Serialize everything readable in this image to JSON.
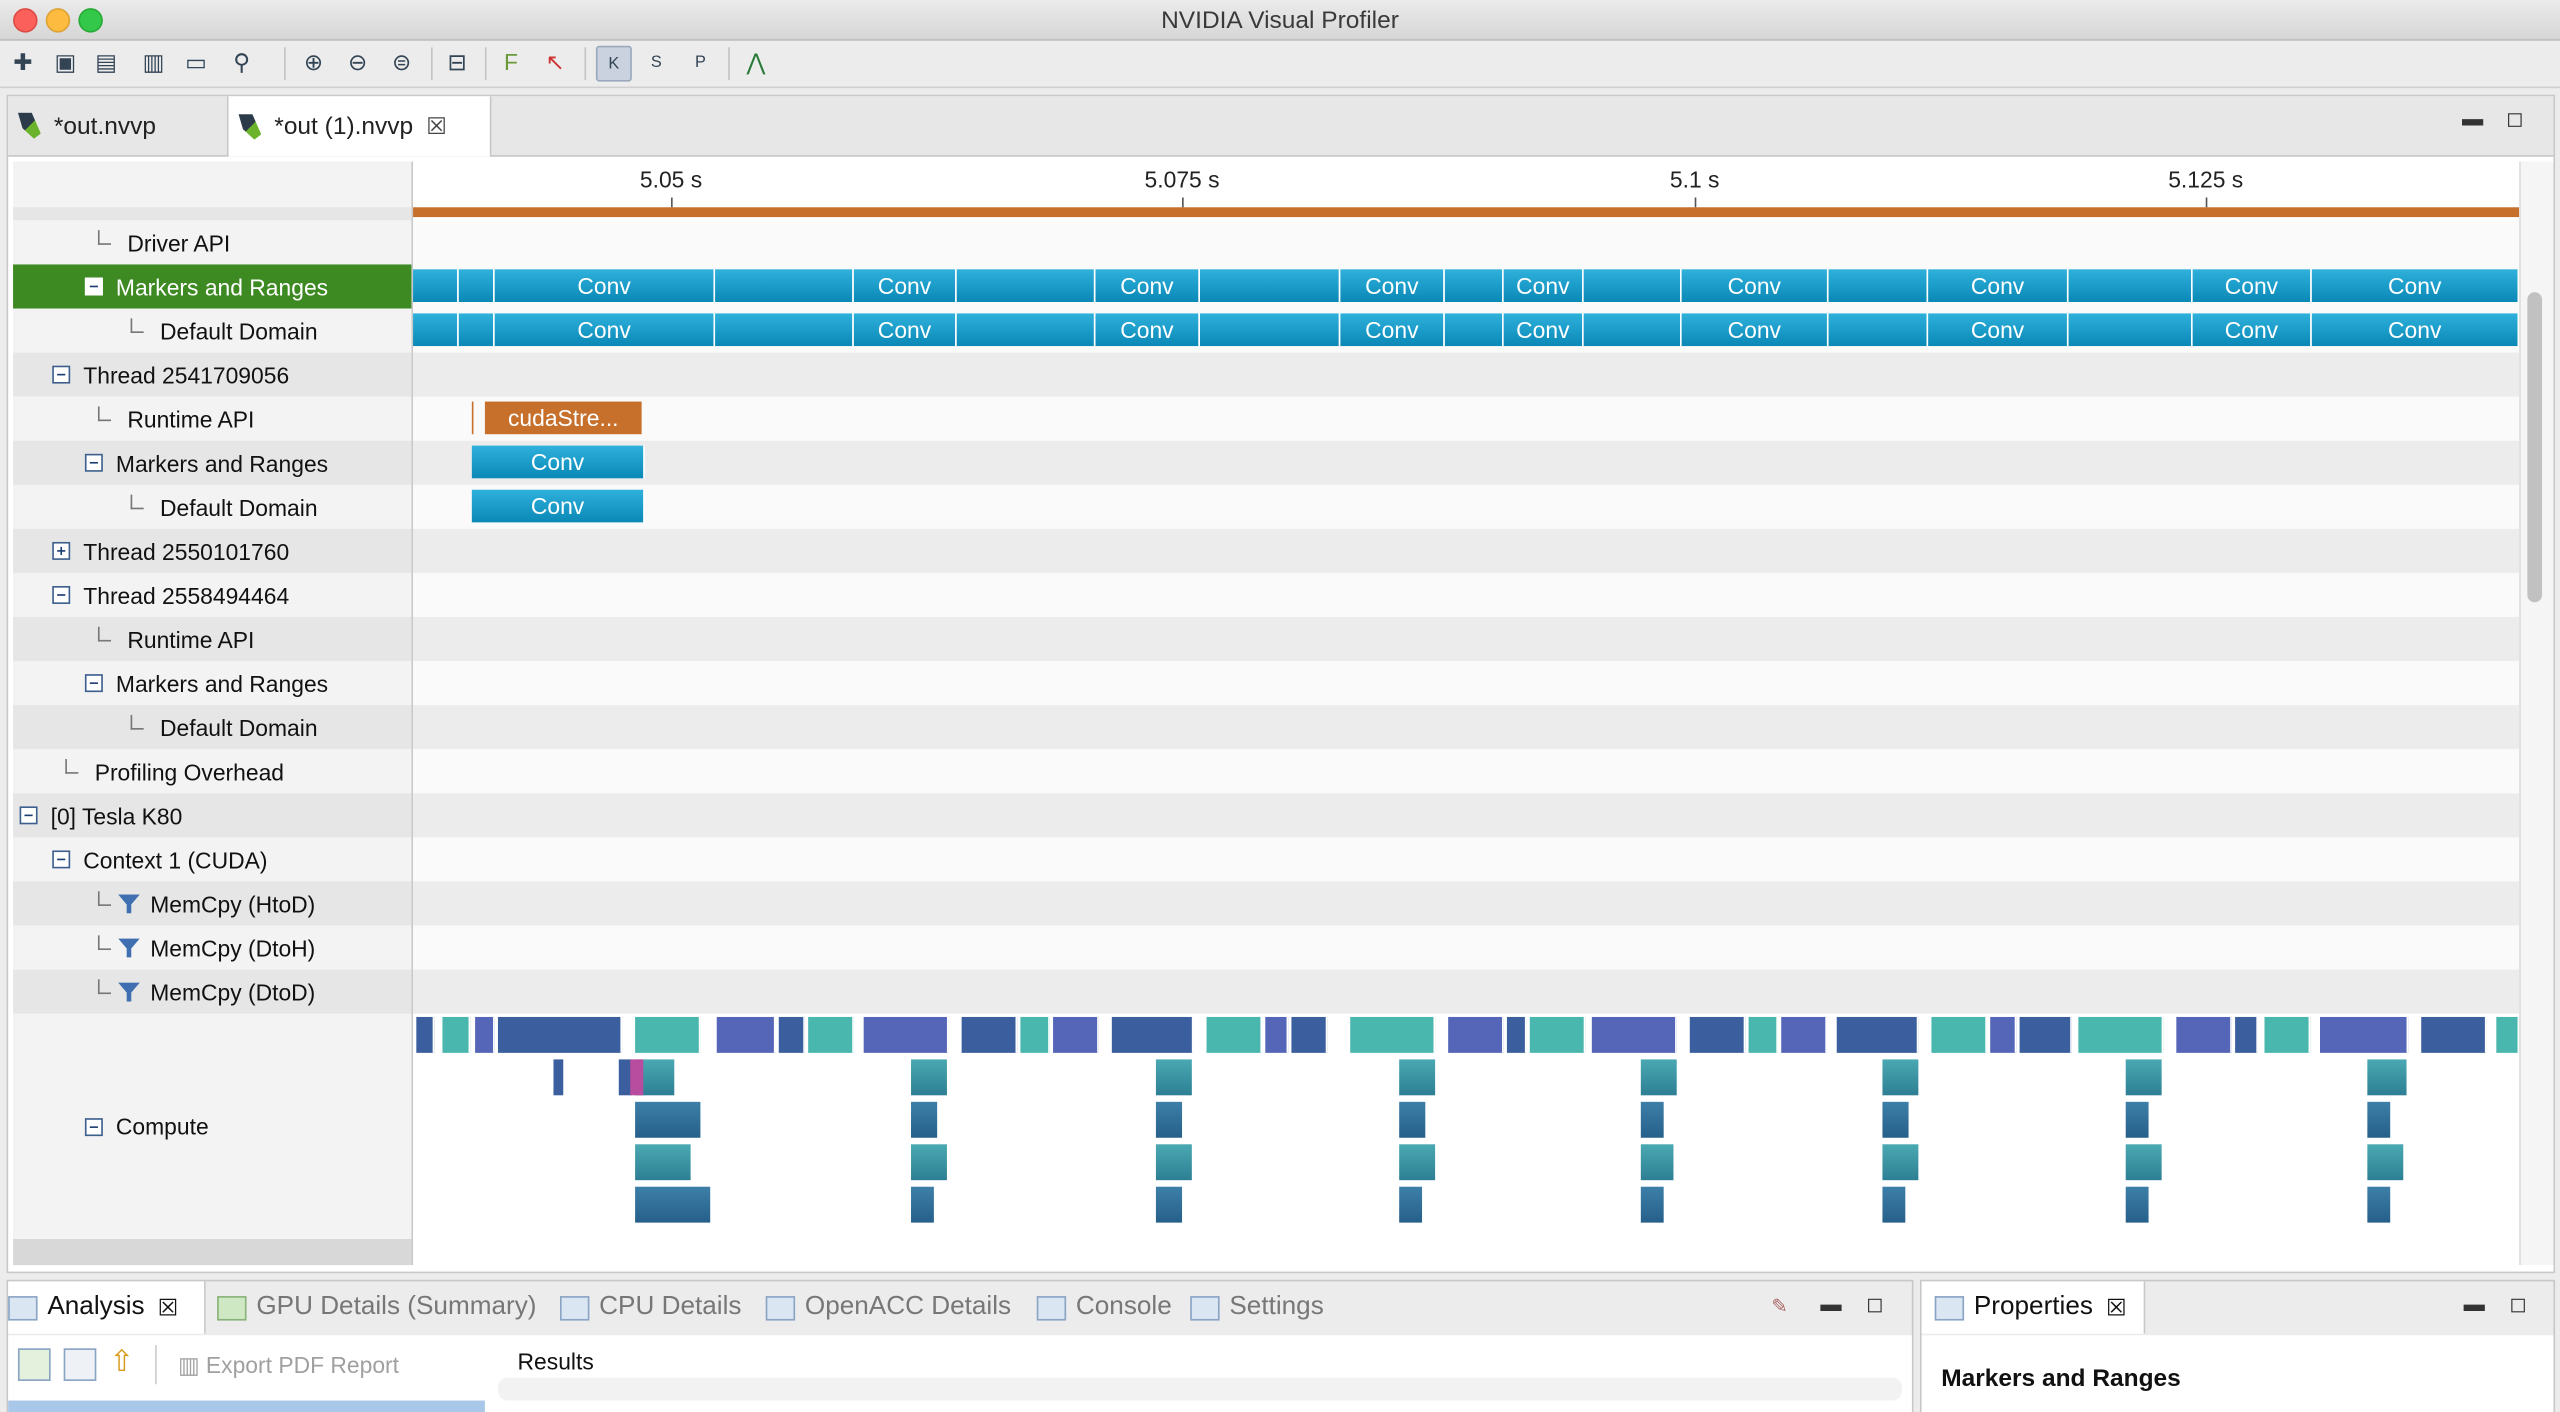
{
  "window": {
    "title": "NVIDIA Visual Profiler"
  },
  "tabs": [
    {
      "label": "*out.nvvp",
      "active": false
    },
    {
      "label": "*out (1).nvvp",
      "active": true
    }
  ],
  "ruler": {
    "ticks": [
      "5.05 s",
      "5.075 s",
      "5.1 s",
      "5.125 s"
    ]
  },
  "tree": [
    {
      "label": "Driver API",
      "kind": "leaf"
    },
    {
      "label": "Markers and Ranges",
      "kind": "minus",
      "selected": true
    },
    {
      "label": "Default Domain",
      "kind": "leaf"
    },
    {
      "label": "Thread 2541709056",
      "kind": "minus"
    },
    {
      "label": "Runtime API",
      "kind": "leaf"
    },
    {
      "label": "Markers and Ranges",
      "kind": "minus"
    },
    {
      "label": "Default Domain",
      "kind": "leaf"
    },
    {
      "label": "Thread 2550101760",
      "kind": "plus"
    },
    {
      "label": "Thread 2558494464",
      "kind": "minus"
    },
    {
      "label": "Runtime API",
      "kind": "leaf"
    },
    {
      "label": "Markers and Ranges",
      "kind": "minus"
    },
    {
      "label": "Default Domain",
      "kind": "leaf"
    },
    {
      "label": "Profiling Overhead",
      "kind": "leaf"
    },
    {
      "label": "[0] Tesla K80",
      "kind": "minus"
    },
    {
      "label": "Context 1 (CUDA)",
      "kind": "minus"
    },
    {
      "label": "MemCpy (HtoD)",
      "kind": "filter"
    },
    {
      "label": "MemCpy (DtoH)",
      "kind": "filter"
    },
    {
      "label": "MemCpy (DtoD)",
      "kind": "filter"
    },
    {
      "label": "Compute",
      "kind": "minus"
    }
  ],
  "timeline": {
    "conv_label": "Conv",
    "cuda_label": "cudaStre..."
  },
  "bottom": {
    "tabs": [
      "Analysis",
      "GPU Details (Summary)",
      "CPU Details",
      "OpenACC Details",
      "Console",
      "Settings"
    ],
    "export_label": "Export PDF Report",
    "results_label": "Results"
  },
  "properties": {
    "tab_label": "Properties",
    "heading": "Markers and Ranges"
  },
  "colors": {
    "highlight": "#3d8a22",
    "marker": "#0a88b6",
    "api": "#c6702c"
  }
}
